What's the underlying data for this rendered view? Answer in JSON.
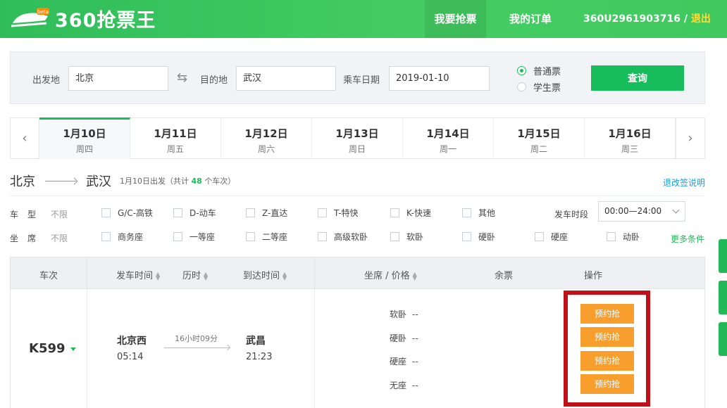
{
  "header": {
    "logo_badge": "beta",
    "logo_text": "360抢票王",
    "nav": [
      "我要抢票",
      "我的订单"
    ],
    "user": "360U2961903716",
    "separator": " / ",
    "logout": "退出"
  },
  "search": {
    "from_label": "出发地",
    "from_value": "北京",
    "to_label": "目的地",
    "to_value": "武汉",
    "date_label": "乘车日期",
    "date_value": "2019-01-10",
    "ticket_types": [
      {
        "label": "普通票",
        "selected": true
      },
      {
        "label": "学生票",
        "selected": false
      }
    ],
    "submit": "查询"
  },
  "dates": [
    {
      "date": "1月10日",
      "weekday": "周四",
      "active": true
    },
    {
      "date": "1月11日",
      "weekday": "周五",
      "active": false
    },
    {
      "date": "1月12日",
      "weekday": "周六",
      "active": false
    },
    {
      "date": "1月13日",
      "weekday": "周日",
      "active": false
    },
    {
      "date": "1月14日",
      "weekday": "周一",
      "active": false
    },
    {
      "date": "1月15日",
      "weekday": "周二",
      "active": false
    },
    {
      "date": "1月16日",
      "weekday": "周三",
      "active": false
    }
  ],
  "route": {
    "from": "北京",
    "to": "武汉",
    "summary_prefix": "1月10日出发（共计",
    "count": "48",
    "summary_suffix": "个车次）",
    "refund_link": "退改签说明"
  },
  "filters": {
    "train_type_label": "车型",
    "seat_label": "坐席",
    "all": "不限",
    "train_types": [
      "G/C-高铁",
      "D-动车",
      "Z-直达",
      "T-特快",
      "K-快速",
      "其他"
    ],
    "seat_types": [
      "商务座",
      "一等座",
      "二等座",
      "高级软卧",
      "软卧",
      "硬卧",
      "硬座",
      "动卧"
    ],
    "period_label": "发车时段",
    "period_value": "00:00—24:00",
    "more": "更多条件"
  },
  "table": {
    "headers": {
      "train": "车次",
      "depart": "发车时间",
      "duration": "历时",
      "arrive": "到达时间",
      "seat_price": "坐席 / 价格",
      "remaining": "余票",
      "action": "操作"
    },
    "rows": [
      {
        "train_no": "K599",
        "from_station": "北京西",
        "depart_time": "05:14",
        "duration": "16小时09分",
        "to_station": "武昌",
        "arrive_time": "21:23",
        "seats": [
          {
            "name": "软卧",
            "price": "--"
          },
          {
            "name": "硬卧",
            "price": "--"
          },
          {
            "name": "硬座",
            "price": "--"
          },
          {
            "name": "无座",
            "price": "--"
          }
        ],
        "action_label": "预约抢"
      }
    ]
  },
  "colors": {
    "brand_green": "#20b957",
    "action_orange": "#f89e2c",
    "highlight_red": "#c0111a",
    "logout_yellow": "#ffde3b"
  }
}
